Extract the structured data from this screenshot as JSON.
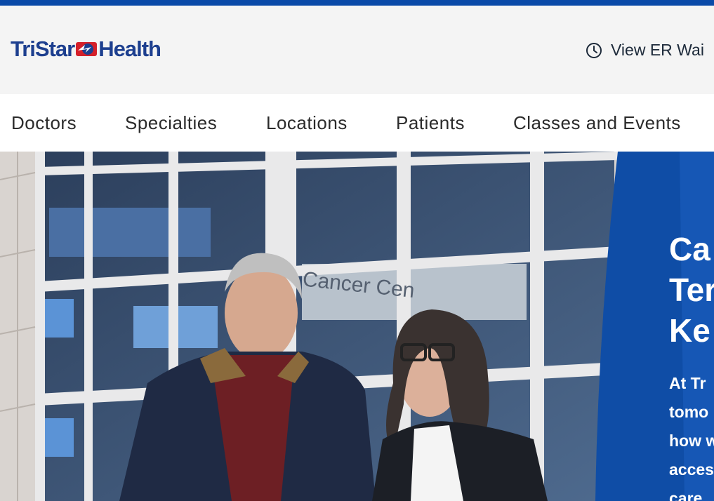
{
  "brand": {
    "logo_text_left": "TriStar",
    "logo_text_right": "Health",
    "accent_color": "#0a4aa8",
    "logo_red": "#d4202a"
  },
  "header": {
    "er_wait_label": "View ER Wai",
    "er_icon": "clock-icon"
  },
  "nav": {
    "items": [
      {
        "label": "Doctors"
      },
      {
        "label": "Specialties"
      },
      {
        "label": "Locations"
      },
      {
        "label": "Patients"
      },
      {
        "label": "Classes and Events"
      }
    ]
  },
  "hero": {
    "image_sign_text": "Cancer Cen",
    "title": "Ca\nTer\nKe",
    "body": "At Tr\ntomo\nhow w\naccess\ncare"
  }
}
